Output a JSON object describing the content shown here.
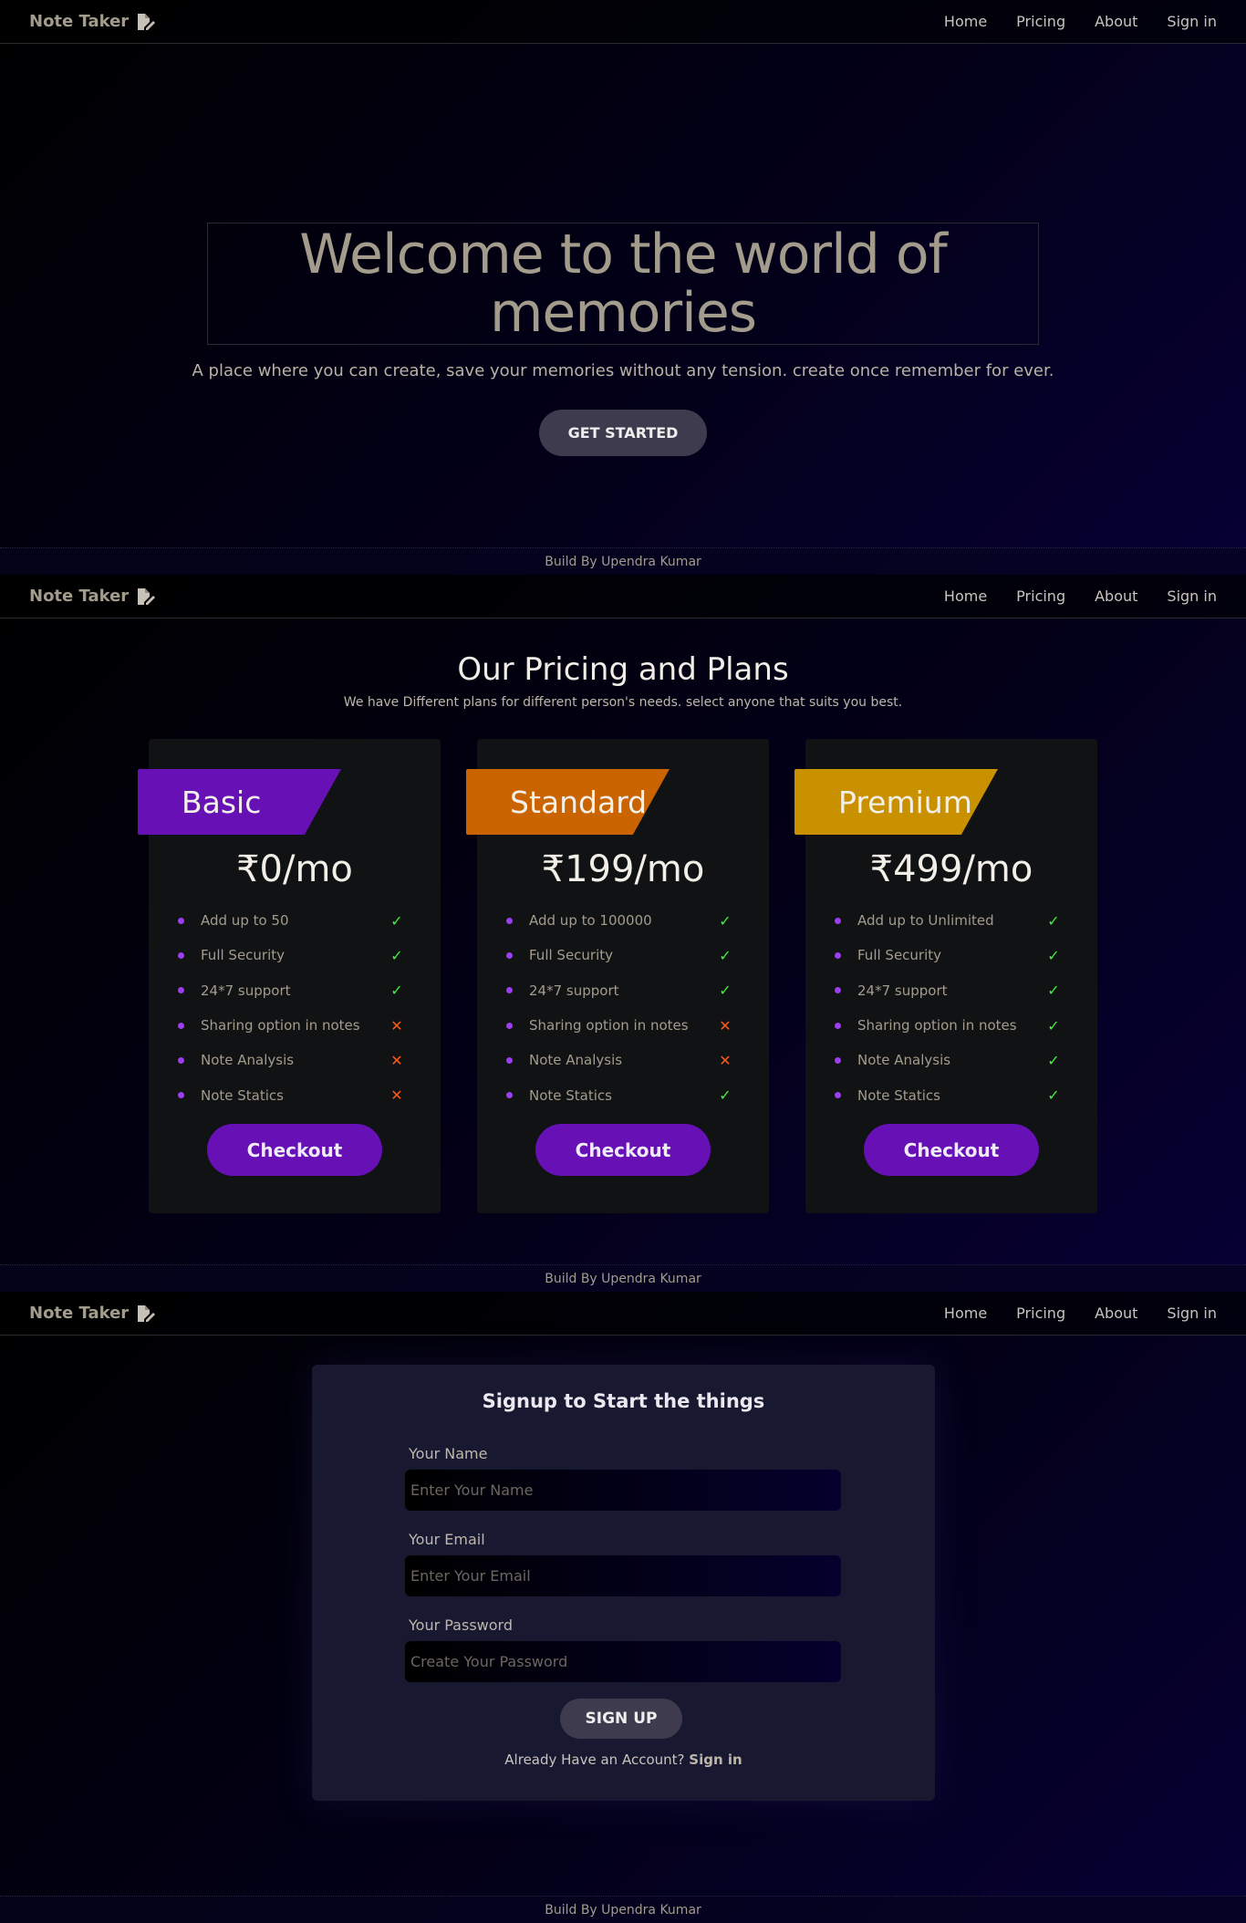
{
  "nav": {
    "brand": "Note Taker",
    "brand_icon": "file-pen-icon",
    "links": [
      "Home",
      "Pricing",
      "About",
      "Sign in"
    ]
  },
  "hero": {
    "title": "Welcome to the world of memories",
    "subtitle": "A place where you can create, save your memories without any tension. create once remember for ever.",
    "cta": "GET STARTED"
  },
  "footer": {
    "text": "Build By Upendra Kumar"
  },
  "pricing": {
    "title": "Our Pricing and Plans",
    "subtitle": "We have Different plans for different person's needs. select anyone that suits you best.",
    "plans": [
      {
        "name": "Basic",
        "price": "₹0/mo",
        "color": "#6610b6",
        "features": [
          {
            "label": "Add up to 50",
            "included": true
          },
          {
            "label": "Full Security",
            "included": true
          },
          {
            "label": "24*7 support",
            "included": true
          },
          {
            "label": "Sharing option in notes",
            "included": false
          },
          {
            "label": "Note Analysis",
            "included": false
          },
          {
            "label": "Note Statics",
            "included": false
          }
        ],
        "button": "Checkout"
      },
      {
        "name": "Standard",
        "price": "₹199/mo",
        "color": "#c96400",
        "features": [
          {
            "label": "Add up to 100000",
            "included": true
          },
          {
            "label": "Full Security",
            "included": true
          },
          {
            "label": "24*7 support",
            "included": true
          },
          {
            "label": "Sharing option in notes",
            "included": false
          },
          {
            "label": "Note Analysis",
            "included": false
          },
          {
            "label": "Note Statics",
            "included": true
          }
        ],
        "button": "Checkout"
      },
      {
        "name": "Premium",
        "price": "₹499/mo",
        "color": "#c99000",
        "features": [
          {
            "label": "Add up to Unlimited",
            "included": true
          },
          {
            "label": "Full Security",
            "included": true
          },
          {
            "label": "24*7 support",
            "included": true
          },
          {
            "label": "Sharing option in notes",
            "included": true
          },
          {
            "label": "Note Analysis",
            "included": true
          },
          {
            "label": "Note Statics",
            "included": true
          }
        ],
        "button": "Checkout"
      }
    ],
    "check_symbol": "✓",
    "cross_symbol": "✕"
  },
  "signup": {
    "title": "Signup to Start the things",
    "name_label": "Your Name",
    "name_placeholder": "Enter Your Name",
    "email_label": "Your Email",
    "email_placeholder": "Enter Your Email",
    "password_label": "Your Password",
    "password_placeholder": "Create Your Password",
    "button": "SIGN UP",
    "already_text": "Already Have an Account?",
    "signin_link": "Sign in"
  }
}
